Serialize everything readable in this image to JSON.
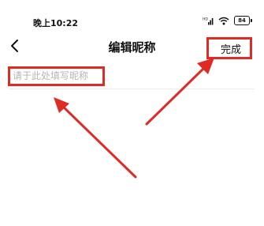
{
  "status_bar": {
    "time": "晚上10:22",
    "battery": "84",
    "icons": [
      "hd-signal-icon",
      "wifi-icon",
      "battery-icon"
    ]
  },
  "header": {
    "title": "编辑昵称",
    "done_label": "完成",
    "back_icon": "chevron-left-icon"
  },
  "nickname": {
    "value": "",
    "placeholder": "请于此处填写昵称"
  },
  "annotations": {
    "highlight_color": "#e02a24"
  }
}
